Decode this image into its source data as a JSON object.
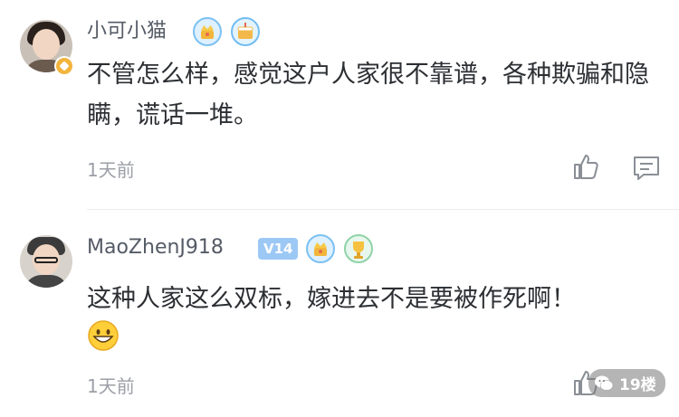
{
  "comments": [
    {
      "username": "小可小猫",
      "vip_label": "",
      "text": "不管怎么样，感觉这户人家很不靠谱，各种欺骗和隐瞒，谎话一堆。",
      "time": "1天前",
      "has_verified_badge": true,
      "badges": [
        "crown-medal-icon",
        "cake-medal-icon"
      ],
      "actions": [
        "like-icon",
        "reply-icon"
      ]
    },
    {
      "username": "MaoZhenJ918",
      "vip_label": "V14",
      "text": "这种人家这么双标，嫁进去不是要被作死啊！",
      "emoji": "grinning-face-emoji",
      "time": "1天前",
      "badges": [
        "crown-medal-icon",
        "trophy-medal-icon"
      ],
      "actions": [
        "like-icon"
      ]
    }
  ],
  "watermark": {
    "text": "19楼",
    "icon": "wechat-icon"
  },
  "colors": {
    "username": "#555b66",
    "body_text": "#2c2f33",
    "meta_text": "#9b9fa6",
    "vip_bg": "#9cc8f5",
    "divider": "#ececec"
  }
}
